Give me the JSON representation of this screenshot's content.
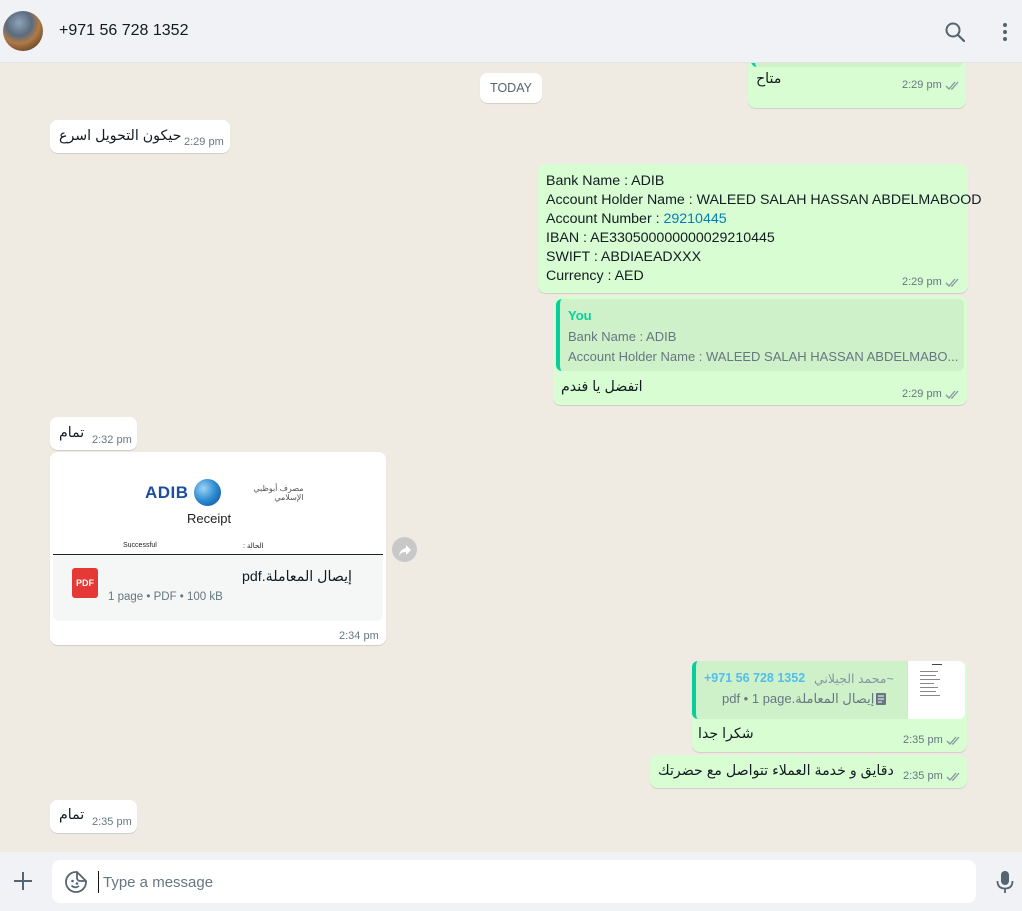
{
  "header": {
    "title": "+971 56 728 1352",
    "icons": [
      "search-icon",
      "menu-icon"
    ]
  },
  "chat": {
    "date_separator": "TODAY",
    "messages": {
      "m0": {
        "text": "متاح",
        "time": "2:29 pm"
      },
      "m1": {
        "text": "حيكون التحويل اسرع",
        "time": "2:29 pm"
      },
      "m2": {
        "line1": "Bank Name : ADIB",
        "line2": "Account Holder Name : WALEED SALAH HASSAN ABDELMABOOD",
        "line3_label": "Account Number : ",
        "line3_value": "29210445",
        "line4": "IBAN : AE330500000000029210445",
        "line5": "SWIFT : ABDIAEADXXX",
        "line6": "Currency : AED",
        "time": "2:29 pm"
      },
      "m3": {
        "quote_author": "You",
        "quote_line1": "Bank Name : ADIB",
        "quote_line2": "Account Holder Name : WALEED SALAH HASSAN ABDELMABO...",
        "text": "اتفضل يا فندم",
        "time": "2:29 pm"
      },
      "m4": {
        "text": "تمام",
        "time": "2:32 pm"
      },
      "m5": {
        "preview_brand": "ADIB",
        "preview_arabic": "مصرف أبوظبي الإسلامي",
        "preview_title": "Receipt",
        "preview_status_left": "Successful",
        "preview_status_right": "الحالة :",
        "file_icon": "PDF",
        "file_name": "إيصال المعاملة.pdf",
        "file_meta": "1 page • PDF • 100 kB",
        "time": "2:34 pm"
      },
      "m6": {
        "quote_author_name": "~محمد الجيلاني",
        "quote_author_phone": "+971 56 728 1352",
        "quote_file": "إيصال المعاملة.pdf • 1 page",
        "text": "شكرا جدا",
        "time": "2:35 pm"
      },
      "m7": {
        "text": "دقايق و خدمة العملاء تتواصل مع حضرتك",
        "time": "2:35 pm"
      },
      "m8": {
        "text": "تمام",
        "time": "2:35 pm"
      }
    }
  },
  "footer": {
    "placeholder": "Type a message",
    "icons": [
      "plus-icon",
      "sticker-icon",
      "microphone-icon"
    ]
  },
  "colors": {
    "outgoing": "#d9fdd3",
    "incoming": "#ffffff",
    "background": "#efeae2",
    "quote_accent": "#06cf9c",
    "tick_read": "#53bdeb"
  }
}
